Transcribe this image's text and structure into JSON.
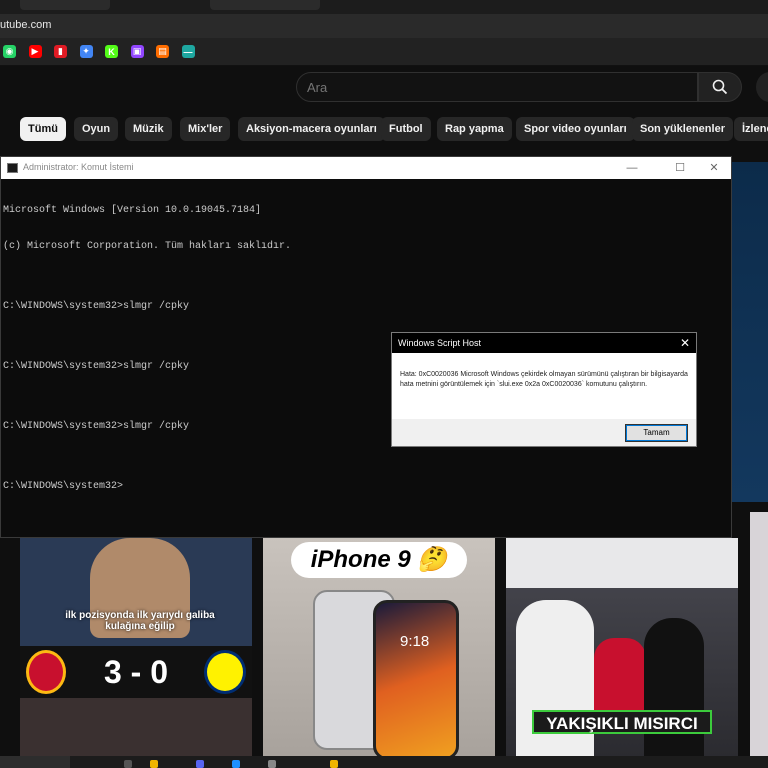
{
  "browser": {
    "url": "utube.com",
    "bookmarks": [
      {
        "name": "whatsapp-icon",
        "color": "#25d366",
        "glyph": "◉"
      },
      {
        "name": "youtube-icon",
        "color": "#ff0000",
        "glyph": "▶"
      },
      {
        "name": "bookmark-red-icon",
        "color": "#e01b24",
        "glyph": "▮"
      },
      {
        "name": "gemini-icon",
        "color": "#4285f4",
        "glyph": "✦"
      },
      {
        "name": "kick-icon",
        "color": "#53fc18",
        "glyph": "K"
      },
      {
        "name": "twitch-icon",
        "color": "#9146ff",
        "glyph": "▣"
      },
      {
        "name": "bookmark-orange-icon",
        "color": "#ff6d00",
        "glyph": "▤"
      },
      {
        "name": "bookmark-teal-icon",
        "color": "#1ea7a0",
        "glyph": "—"
      }
    ]
  },
  "youtube": {
    "search_placeholder": "Ara",
    "chips": [
      "Tümü",
      "Oyun",
      "Müzik",
      "Mix'ler",
      "Aksiyon-macera oyunları",
      "Futbol",
      "Rap yapma",
      "Spor video oyunları",
      "Son yüklenenler",
      "İzlene"
    ],
    "thumbnails": [
      {
        "caption": "ilk pozisyonda ilk yarıydı galiba kulağına eğilip",
        "score": "3 - 0"
      },
      {
        "title": "iPhone 9",
        "emoji": "🤔",
        "time": "9:18"
      },
      {
        "caption": "YAKIŞIKLI MISIRCI"
      }
    ]
  },
  "cmd": {
    "title": "Administrator: Komut İstemi",
    "lines": [
      "Microsoft Windows [Version 10.0.19045.7184]",
      "(c) Microsoft Corporation. Tüm hakları saklıdır.",
      "",
      "C:\\WINDOWS\\system32>slmgr /cpky",
      "",
      "C:\\WINDOWS\\system32>slmgr /cpky",
      "",
      "C:\\WINDOWS\\system32>slmgr /cpky",
      "",
      "C:\\WINDOWS\\system32>"
    ]
  },
  "dialog": {
    "title": "Windows Script Host",
    "message": "Hata: 0xC0020036 Microsoft Windows çekirdek olmayan sürümünü çalıştıran bir bilgisayarda hata metnini görüntülemek için `slui.exe 0x2a 0xC0020036` komutunu çalıştırın.",
    "ok_label": "Tamam"
  }
}
